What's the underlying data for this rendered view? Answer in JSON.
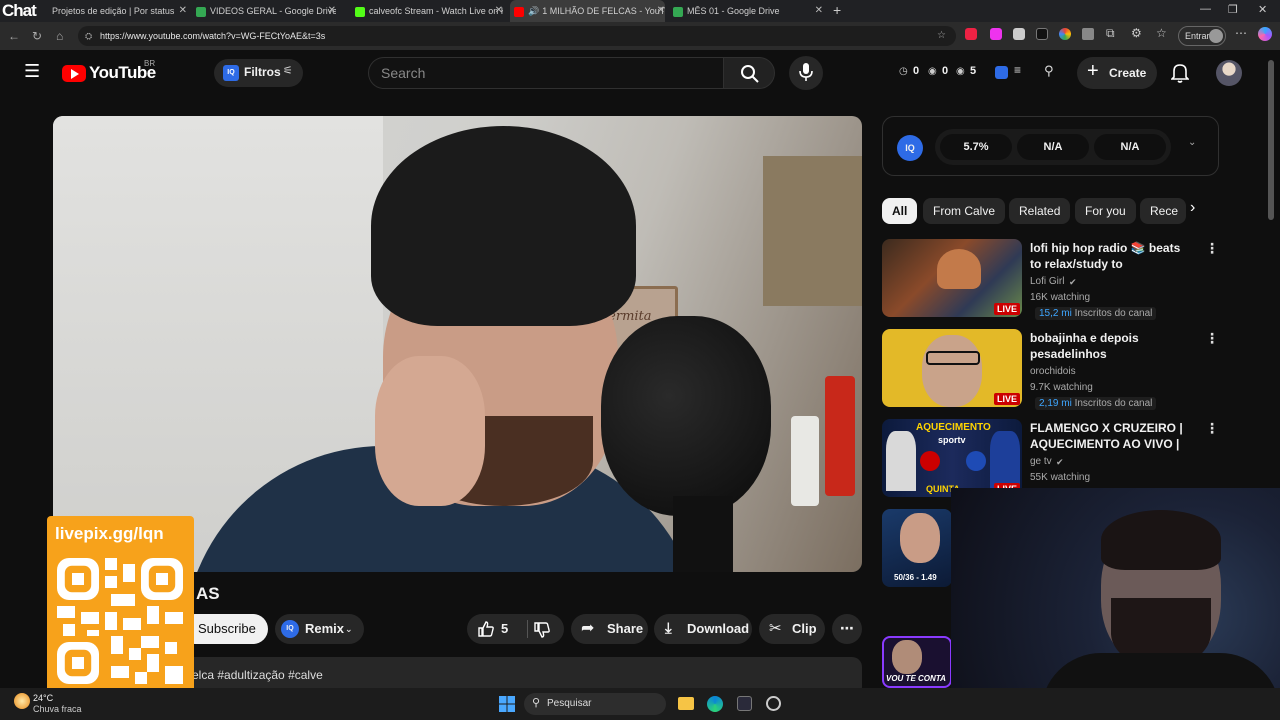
{
  "overlay": {
    "chat_label": "Chat"
  },
  "tabs": [
    {
      "label": "Projetos de edição | Por status",
      "color": "#d06bff"
    },
    {
      "label": "VIDEOS GERAL - Google Drive",
      "color": "#34a853"
    },
    {
      "label": "calveofc Stream - Watch Live on K",
      "color": "#53fc18"
    },
    {
      "label": "1 MILHÃO DE FELCAS - YouT",
      "color": "#ff0000"
    },
    {
      "label": "MÊS 01 - Google Drive",
      "color": "#34a853"
    }
  ],
  "browser": {
    "url": "https://www.youtube.com/watch?v=WG-FECtYoAE&t=3s",
    "profile_label": "Entrar"
  },
  "header": {
    "logo_text": "YouTube",
    "region": "BR",
    "filter_label": "Filtros",
    "search_placeholder": "Search",
    "stat_views": "0",
    "stat_watch": "0",
    "stat_count": "5",
    "create_label": "Create"
  },
  "iq_panel": {
    "badge": "IQ",
    "metrics": [
      "5.7%",
      "N/A",
      "N/A"
    ]
  },
  "chips": [
    "All",
    "From Calve",
    "Related",
    "For you",
    "Rece"
  ],
  "recommendations": [
    {
      "title": "lofi hip hop radio 📚 beats to relax/study to",
      "channel": "Lofi Girl",
      "verified": true,
      "watching": "16K watching",
      "subs_value": "15,2 mi",
      "subs_label": "Inscritos do canal",
      "live": "LIVE"
    },
    {
      "title": "bobajinha e depois pesadelinhos",
      "channel": "orochidois",
      "verified": false,
      "watching": "9.7K watching",
      "subs_value": "2,19 mi",
      "subs_label": "Inscritos do canal",
      "live": "LIVE"
    },
    {
      "title": "FLAMENGO X CRUZEIRO | AQUECIMENTO AO VIVO | ...",
      "channel": "ge tv",
      "verified": true,
      "watching": "55K watching",
      "thumb_top": "AQUECIMENTO",
      "thumb_brand": "sportv",
      "thumb_bottom": "QUINTA",
      "live": "LIVE"
    },
    {
      "thumb_caption": "50/36 - 1.49"
    },
    {
      "thumb_caption": "VOU TE CONTA"
    }
  ],
  "video": {
    "title_fragment": "AS",
    "subscribe_label": "Subscribe",
    "remix_label": "Remix",
    "like_count": "5",
    "share_label": "Share",
    "download_label": "Download",
    "clip_label": "Clip",
    "description_fragment": "elca #adultização #calve",
    "wall_sign": "Permita"
  },
  "qr_overlay": {
    "url": "livepix.gg/lqn"
  },
  "taskbar": {
    "temp": "24°C",
    "weather": "Chuva fraca",
    "search_label": "Pesquisar"
  }
}
